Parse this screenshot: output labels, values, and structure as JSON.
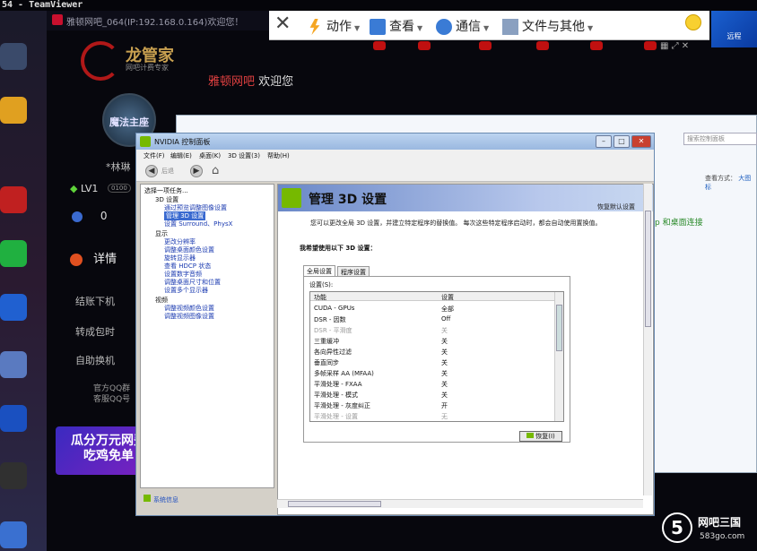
{
  "teamviewer": {
    "title": "54 - TeamViewer",
    "toolbar": {
      "actions": "动作",
      "view": "查看",
      "communicate": "通信",
      "files": "文件与其他",
      "remote_badge": "远程"
    }
  },
  "cafe": {
    "window_title": "雅顿网吧_064(IP:192.168.0.164)欢迎您！",
    "brand": "龙管家",
    "brand_sub": "网吧计费专家",
    "welcome_prefix": "雅顿网吧",
    "welcome_suffix": "欢迎您",
    "avatar_text": "魔法主座",
    "username": "*林琳",
    "level": "LV1",
    "level_badge": "0100",
    "coins": "0",
    "details": "详情",
    "menu": [
      "结账下机",
      "转成包时",
      "自助换机"
    ],
    "qq_group_line1": "官方QQ群",
    "qq_group_line2": "客服QQ号",
    "ad_line1": "瓜分万元网费",
    "ad_line2": "吃鸡免单"
  },
  "background_window": {
    "search_placeholder": "搜索控制面板",
    "view_label": "查看方式：",
    "view_value": "大图标",
    "link_text": "p 和桌面连接"
  },
  "nvidia": {
    "title": "NVIDIA 控制面板",
    "menu": [
      "文件(F)",
      "编辑(E)",
      "桌面(K)",
      "3D 设置(3)",
      "帮助(H)"
    ],
    "toolbar": {
      "back": "后退"
    },
    "tree_heading": "选择一项任务...",
    "tree": [
      {
        "label": "3D 设置",
        "type": "node"
      },
      {
        "label": "通过预览调整图像设置",
        "type": "leaf"
      },
      {
        "label": "管理 3D 设置",
        "type": "leaf",
        "selected": true
      },
      {
        "label": "设置 Surround、PhysX",
        "type": "leaf"
      },
      {
        "label": "显示",
        "type": "node"
      },
      {
        "label": "更改分辨率",
        "type": "leaf"
      },
      {
        "label": "调整桌面颜色设置",
        "type": "leaf"
      },
      {
        "label": "旋转显示器",
        "type": "leaf"
      },
      {
        "label": "查看 HDCP 状态",
        "type": "leaf"
      },
      {
        "label": "设置数字音频",
        "type": "leaf"
      },
      {
        "label": "调整桌面尺寸和位置",
        "type": "leaf"
      },
      {
        "label": "设置多个显示器",
        "type": "leaf"
      },
      {
        "label": "视频",
        "type": "node"
      },
      {
        "label": "调整视频颜色设置",
        "type": "leaf"
      },
      {
        "label": "调整视频图像设置",
        "type": "leaf"
      }
    ],
    "system_info": "系统信息",
    "page_title": "管理 3D 设置",
    "restore_defaults": "恢复默认设置",
    "description": "您可以更改全局 3D 设置，并建立特定程序的替换值。 每次这些特定程序启动时，都会自动使用置换值。",
    "want_label": "我希望使用以下 3D 设置：",
    "tabs": {
      "global": "全局设置",
      "program": "程序设置"
    },
    "settings_label": "设置(S):",
    "columns": {
      "feature": "功能",
      "setting": "设置"
    },
    "rows": [
      {
        "feature": "CUDA - GPUs",
        "value": "全部",
        "dim": false
      },
      {
        "feature": "DSR - 因数",
        "value": "Off",
        "dim": false
      },
      {
        "feature": "DSR - 平滑度",
        "value": "关",
        "dim": true
      },
      {
        "feature": "三重缓冲",
        "value": "关",
        "dim": false
      },
      {
        "feature": "各向异性过滤",
        "value": "关",
        "dim": false
      },
      {
        "feature": "垂直同步",
        "value": "关",
        "dim": false
      },
      {
        "feature": "多帧采样 AA (MFAA)",
        "value": "关",
        "dim": false
      },
      {
        "feature": "平滑处理 - FXAA",
        "value": "关",
        "dim": false
      },
      {
        "feature": "平滑处理 - 模式",
        "value": "关",
        "dim": false
      },
      {
        "feature": "平滑处理 - 灰度纠正",
        "value": "开",
        "dim": false
      },
      {
        "feature": "平滑处理 - 设置",
        "value": "无",
        "dim": true
      }
    ],
    "restore_button": "恢复(I)"
  },
  "watermark": {
    "number": "5",
    "text": "网吧三国",
    "site": "583go.com"
  },
  "colors": {
    "nvidia_green": "#76b900",
    "header_blue": "#6a88c8"
  }
}
